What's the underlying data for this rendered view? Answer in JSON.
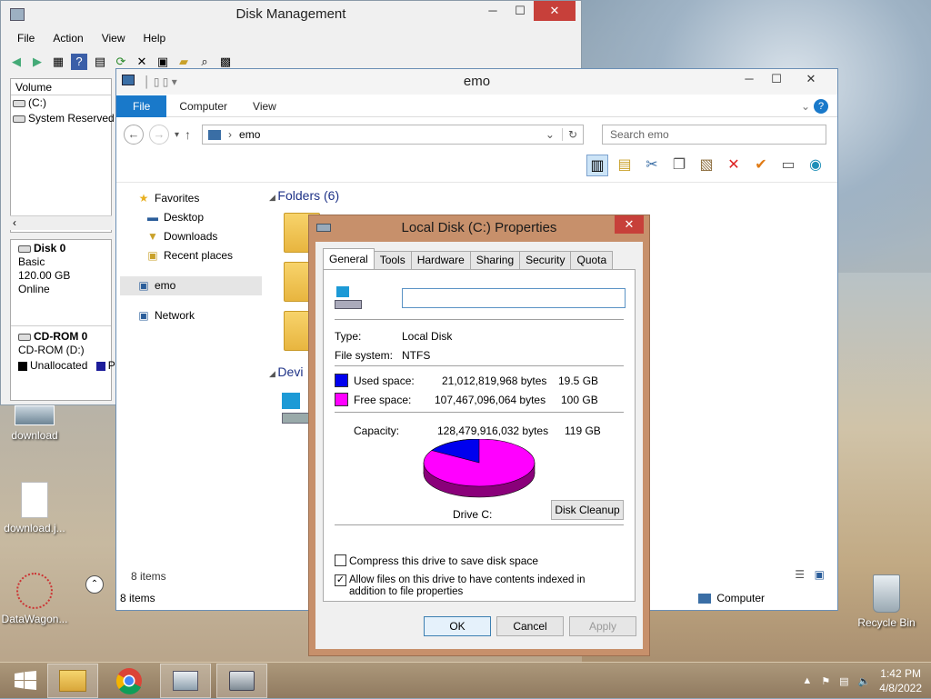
{
  "desktop": {
    "icons": [
      {
        "label": "download"
      },
      {
        "label": "download.j..."
      },
      {
        "label": "DataWagon..."
      },
      {
        "label": "Recycle Bin"
      }
    ]
  },
  "disk_mgmt": {
    "title": "Disk Management",
    "menu": [
      "File",
      "Action",
      "View",
      "Help"
    ],
    "volume_header": "Volume",
    "volumes": [
      "(C:)",
      "System Reserved"
    ],
    "disk0": {
      "name": "Disk 0",
      "type": "Basic",
      "size": "120.00 GB",
      "status": "Online"
    },
    "cdrom": {
      "name": "CD-ROM 0",
      "sub": "CD-ROM (D:)"
    },
    "legend": {
      "unallocated": "Unallocated",
      "primary_initial": "P"
    },
    "minimize": "─",
    "maximize": "☐",
    "close": "✕"
  },
  "explorer": {
    "title": "emo",
    "tabs": [
      "File",
      "Computer",
      "View"
    ],
    "address": "emo",
    "search_placeholder": "Search emo",
    "nav": {
      "favorites": "Favorites",
      "desktop": "Desktop",
      "downloads": "Downloads",
      "recent": "Recent places",
      "computer": "emo",
      "network": "Network"
    },
    "group_folders": "Folders (6)",
    "group_devices": "Devi",
    "items_count_inner": "8 items",
    "items_count": "8 items",
    "computer_label": "Computer",
    "minimize": "─",
    "maximize": "☐",
    "close": "✕",
    "help": "?"
  },
  "props": {
    "title": "Local Disk (C:) Properties",
    "close": "✕",
    "tabs": [
      "General",
      "Tools",
      "Hardware",
      "Sharing",
      "Security",
      "Quota"
    ],
    "active_tab": "General",
    "name_value": "",
    "type_label": "Type:",
    "type_value": "Local Disk",
    "fs_label": "File system:",
    "fs_value": "NTFS",
    "used_label": "Used space:",
    "used_bytes": "21,012,819,968 bytes",
    "used_gb": "19.5 GB",
    "free_label": "Free space:",
    "free_bytes": "107,467,096,064 bytes",
    "free_gb": "100 GB",
    "cap_label": "Capacity:",
    "cap_bytes": "128,479,916,032 bytes",
    "cap_gb": "119 GB",
    "drive_label": "Drive C:",
    "cleanup": "Disk Cleanup",
    "compress_label": "Compress this drive to save disk space",
    "compress_checked": false,
    "index_label": "Allow files on this drive to have contents indexed in addition to file properties",
    "index_checked": true,
    "ok": "OK",
    "cancel": "Cancel",
    "apply": "Apply",
    "used_color": "#0000ee",
    "free_color": "#ff00ff",
    "used_fraction": 0.1635
  },
  "taskbar": {
    "time": "1:42 PM",
    "date": "4/8/2022"
  }
}
